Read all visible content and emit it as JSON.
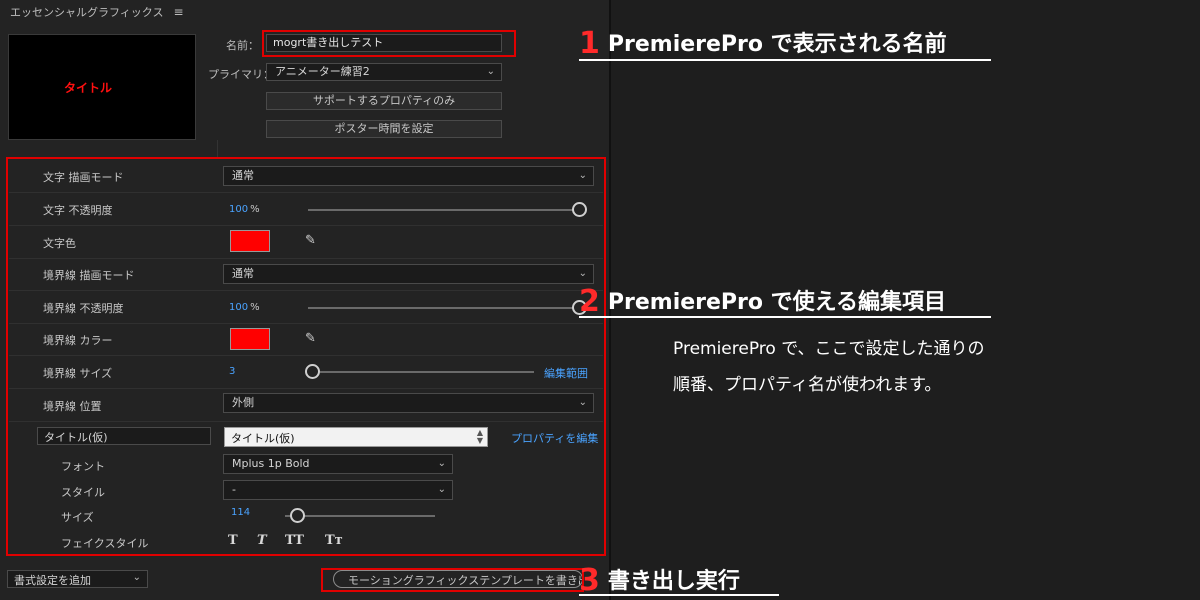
{
  "panel": {
    "title": "エッセンシャルグラフィックス",
    "menu_icon": "≡",
    "preview_text": "タイトル",
    "name_label": "名前：",
    "name_value": "mogrt書き出しテスト",
    "primary_label": "プライマリ：",
    "primary_value": "アニメーター練習2",
    "btn_supported": "サポートするプロパティのみ",
    "btn_poster": "ポスター時間を設定"
  },
  "props": {
    "text_blend_label": "文字 描画モード",
    "text_blend_value": "通常",
    "text_opacity_label": "文字 不透明度",
    "text_opacity_value": "100",
    "percent_unit": "%",
    "text_color_label": "文字色",
    "border_blend_label": "境界線 描画モード",
    "border_blend_value": "通常",
    "border_opacity_label": "境界線 不透明度",
    "border_opacity_value": "100",
    "border_color_label": "境界線 カラー",
    "border_size_label": "境界線 サイズ",
    "border_size_value": "3",
    "edit_range": "編集範囲",
    "border_pos_label": "境界線 位置",
    "border_pos_value": "外側",
    "text_name_value": "タイトル(仮)",
    "text_content_value": "タイトル(仮)",
    "edit_props_link": "プロパティを編集",
    "font_label": "フォント",
    "font_value": "Mplus 1p Bold",
    "style_label": "スタイル",
    "style_value": "-",
    "size_label": "サイズ",
    "size_value": "114",
    "faux_label": "フェイクスタイル",
    "faux_styles": [
      "T",
      "T",
      "TT",
      "Tт"
    ]
  },
  "footer": {
    "add_format": "書式設定を追加",
    "export_button": "モーショングラフィックステンプレートを書き出し..."
  },
  "annotations": {
    "a1_num": "1",
    "a1_text": "PremierePro で表示される名前",
    "a2_num": "2",
    "a2_text": "PremierePro で使える編集項目",
    "desc_line1": "PremierePro で、ここで設定した通りの",
    "desc_line2": "順番、プロパティ名が使われます。",
    "a3_num": "3",
    "a3_text": "書き出し実行"
  },
  "colors": {
    "swatch": "#ff0000",
    "highlight_box": "#e00000",
    "accent_link": "#4aa3ff",
    "annotation_number": "#ff2a2a"
  }
}
